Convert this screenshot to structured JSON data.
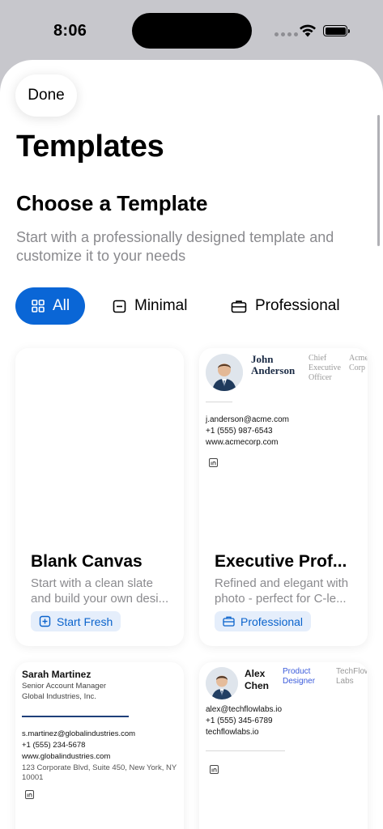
{
  "status": {
    "time": "8:06"
  },
  "header": {
    "done_label": "Done",
    "title": "Templates"
  },
  "section": {
    "title": "Choose a Template",
    "subtitle": "Start with a professionally designed template and customize it to your needs"
  },
  "filters": [
    {
      "label": "All",
      "icon": "grid-icon",
      "selected": true
    },
    {
      "label": "Minimal",
      "icon": "square-minus-icon",
      "selected": false
    },
    {
      "label": "Professional",
      "icon": "briefcase-icon",
      "selected": false
    }
  ],
  "colors": {
    "accent": "#0a66d6",
    "badge_bg": "#e5eefb",
    "badge_text": "#0a63cc",
    "navy_rule": "#1f3f7a"
  },
  "cards": [
    {
      "title": "Blank Canvas",
      "desc_line1": "Start with a clean slate",
      "desc_line2": "and build your own desi...",
      "badge": "Start Fresh",
      "badge_icon": "plus-square-icon"
    },
    {
      "title": "Executive Prof...",
      "desc_line1": "Refined and elegant with",
      "desc_line2": "photo - perfect for C-le...",
      "badge": "Professional",
      "badge_icon": "briefcase-icon",
      "preview": {
        "name_line1": "John",
        "name_line2": "Anderson",
        "role_line1": "Chief",
        "role_line2": "Executive",
        "role_line3": "Officer",
        "company_line1": "Acme",
        "company_line2": "Corp",
        "email": "j.anderson@acme.com",
        "phone": "+1 (555) 987-6543",
        "website": "www.acmecorp.com"
      }
    },
    {
      "preview": {
        "name": "Sarah Martinez",
        "role": "Senior Account Manager",
        "company": "Global Industries, Inc.",
        "email": "s.martinez@globalindustries.com",
        "phone": "+1 (555) 234-5678",
        "website": "www.globalindustries.com",
        "address_line1": "123 Corporate Blvd, Suite 450, New York, NY",
        "address_line2": "10001"
      }
    },
    {
      "preview": {
        "name_line1": "Alex",
        "name_line2": "Chen",
        "role_line1": "Product",
        "role_line2": "Designer",
        "company_line1": "TechFlow",
        "company_line2": "Labs",
        "email": "alex@techflowlabs.io",
        "phone": "+1 (555) 345-6789",
        "website": "techflowlabs.io"
      }
    }
  ]
}
